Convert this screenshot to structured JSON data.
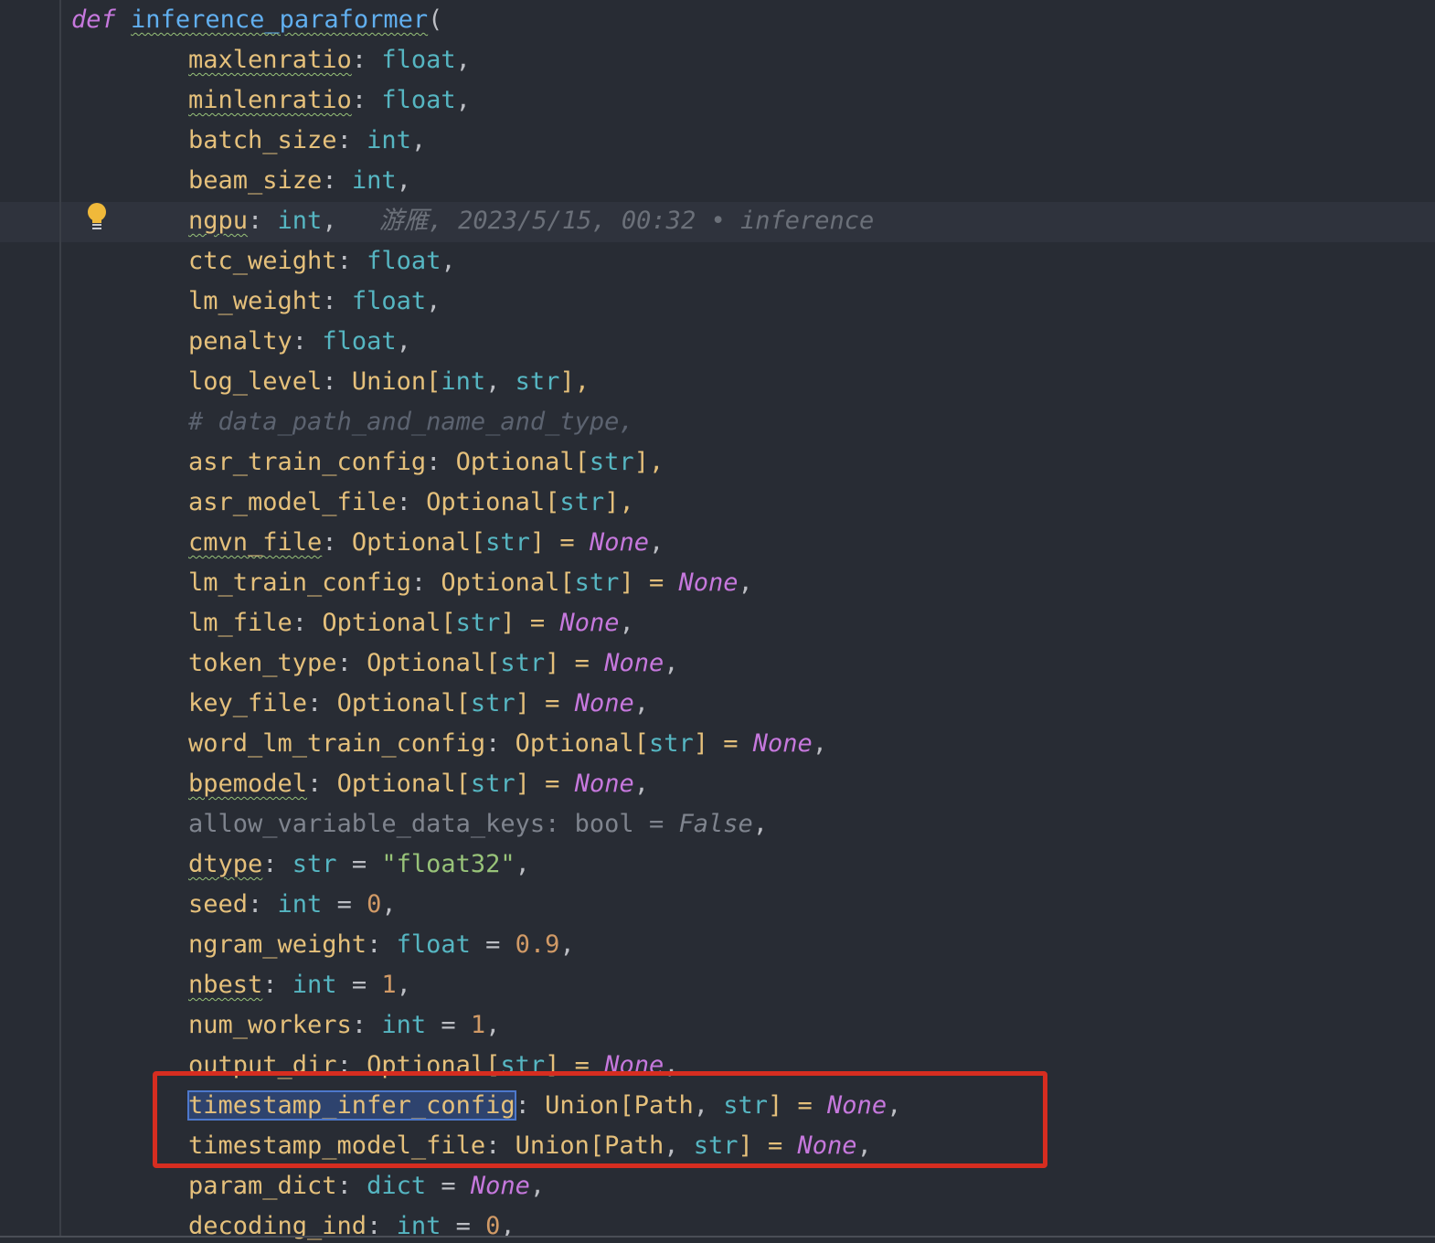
{
  "editor": {
    "blame": {
      "author": "游雁",
      "date": "2023/5/15, 00:32",
      "separator": "•",
      "message": "inference"
    },
    "colors": {
      "background": "#282c34",
      "keyword": "#c678dd",
      "function": "#61afef",
      "parameter": "#e5c07b",
      "builtin": "#56b6c2",
      "number": "#d19a66",
      "string": "#98c379",
      "comment": "#5c6370",
      "highlight_box": "#d62d20"
    },
    "icons": {
      "intention_bulb": "lightbulb-icon"
    },
    "lines": [
      {
        "t": [
          "def",
          " ",
          "inference_paraformer",
          "("
        ]
      },
      {
        "t": [
          "maxlenratio",
          ": ",
          "float",
          ","
        ]
      },
      {
        "t": [
          "minlenratio",
          ": ",
          "float",
          ","
        ]
      },
      {
        "t": [
          "batch_size",
          ": ",
          "int",
          ","
        ]
      },
      {
        "t": [
          "beam_size",
          ": ",
          "int",
          ","
        ]
      },
      {
        "t": [
          "ngpu",
          ": ",
          "int",
          ","
        ]
      },
      {
        "t": [
          "ctc_weight",
          ": ",
          "float",
          ","
        ]
      },
      {
        "t": [
          "lm_weight",
          ": ",
          "float",
          ","
        ]
      },
      {
        "t": [
          "penalty",
          ": ",
          "float",
          ","
        ]
      },
      {
        "t": [
          "log_level",
          ": ",
          "Union",
          "[",
          "int",
          ", ",
          "str",
          "],"
        ]
      },
      {
        "t": [
          "# data_path_and_name_and_type,"
        ]
      },
      {
        "t": [
          "asr_train_config",
          ": ",
          "Optional",
          "[",
          "str",
          "],"
        ]
      },
      {
        "t": [
          "asr_model_file",
          ": ",
          "Optional",
          "[",
          "str",
          "],"
        ]
      },
      {
        "t": [
          "cmvn_file",
          ": ",
          "Optional",
          "[",
          "str",
          "] = ",
          "None",
          ","
        ]
      },
      {
        "t": [
          "lm_train_config",
          ": ",
          "Optional",
          "[",
          "str",
          "] = ",
          "None",
          ","
        ]
      },
      {
        "t": [
          "lm_file",
          ": ",
          "Optional",
          "[",
          "str",
          "] = ",
          "None",
          ","
        ]
      },
      {
        "t": [
          "token_type",
          ": ",
          "Optional",
          "[",
          "str",
          "] = ",
          "None",
          ","
        ]
      },
      {
        "t": [
          "key_file",
          ": ",
          "Optional",
          "[",
          "str",
          "] = ",
          "None",
          ","
        ]
      },
      {
        "t": [
          "word_lm_train_config",
          ": ",
          "Optional",
          "[",
          "str",
          "] = ",
          "None",
          ","
        ]
      },
      {
        "t": [
          "bpemodel",
          ": ",
          "Optional",
          "[",
          "str",
          "] = ",
          "None",
          ","
        ]
      },
      {
        "t": [
          "allow_variable_data_keys",
          ": ",
          "bool",
          " = ",
          "False",
          ","
        ]
      },
      {
        "t": [
          "dtype",
          ": ",
          "str",
          " = ",
          "\"float32\"",
          ","
        ]
      },
      {
        "t": [
          "seed",
          ": ",
          "int",
          " = ",
          "0",
          ","
        ]
      },
      {
        "t": [
          "ngram_weight",
          ": ",
          "float",
          " = ",
          "0.9",
          ","
        ]
      },
      {
        "t": [
          "nbest",
          ": ",
          "int",
          " = ",
          "1",
          ","
        ]
      },
      {
        "t": [
          "num_workers",
          ": ",
          "int",
          " = ",
          "1",
          ","
        ]
      },
      {
        "t": [
          "output_dir",
          ": ",
          "Optional",
          "[",
          "str",
          "] = ",
          "None",
          ","
        ]
      },
      {
        "t": [
          "timestamp_infer_config",
          ": ",
          "Union",
          "[",
          "Path",
          ", ",
          "str",
          "] = ",
          "None",
          ","
        ]
      },
      {
        "t": [
          "timestamp_model_file",
          ": ",
          "Union",
          "[",
          "Path",
          ", ",
          "str",
          "] = ",
          "None",
          ","
        ]
      },
      {
        "t": [
          "param_dict",
          ": ",
          "dict",
          " = ",
          "None",
          ","
        ]
      },
      {
        "t": [
          "decoding_ind",
          ": ",
          "int",
          " = ",
          "0",
          ","
        ]
      }
    ]
  }
}
